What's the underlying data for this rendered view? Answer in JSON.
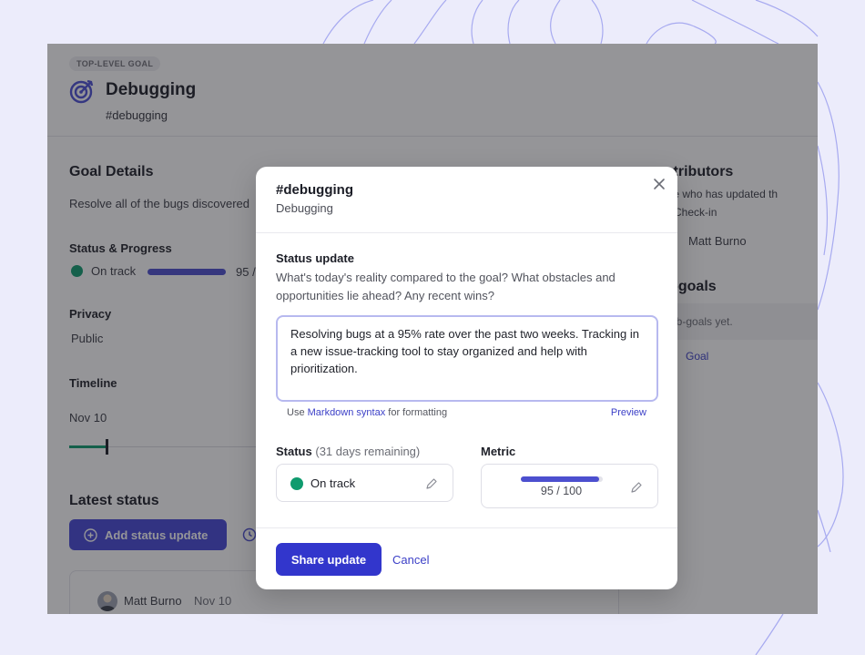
{
  "app": {
    "level_badge": "TOP-LEVEL GOAL",
    "goal_title": "Debugging",
    "goal_tag": "#debugging",
    "details": {
      "heading": "Goal Details",
      "description": "Resolve all of the bugs discovered",
      "status_label": "Status & Progress",
      "status_value": "On track",
      "progress_text": "95 /",
      "progress": 0.95,
      "privacy_label": "Privacy",
      "privacy_value": "Public",
      "timeline_label": "Timeline",
      "timeline_date": "Nov 10"
    },
    "latest": {
      "heading": "Latest status",
      "add_button": "Add status update",
      "author": "Matt Burno",
      "date": "Nov 10"
    },
    "right": {
      "contributors_heading": "ontributors",
      "contributors_note_1": "yone who has updated th",
      "contributors_note_2": "n a Check-in",
      "contributor_name": "Matt Burno",
      "subgoals_heading": "ub-goals",
      "subgoals_empty": "o sub-goals yet.",
      "add_goal": "Goal"
    }
  },
  "modal": {
    "title": "#debugging",
    "subtitle": "Debugging",
    "question_label": "Status update",
    "question_help": "What's today's reality compared to the goal? What obstacles and opportunities lie ahead? Any recent wins?",
    "update_text": "Resolving bugs at a 95% rate over the past two weeks. Tracking in a new issue-tracking tool to stay organized and help with prioritization.",
    "hint_prefix": "Use ",
    "hint_link": "Markdown syntax",
    "hint_suffix": " for formatting",
    "preview": "Preview",
    "status_label": "Status",
    "status_remaining": "(31 days remaining)",
    "status_value": "On track",
    "metric_label": "Metric",
    "metric_value": "95 / 100",
    "metric_progress": 0.95,
    "share_button": "Share update",
    "cancel_button": "Cancel"
  },
  "colors": {
    "accent": "#3236cc",
    "on_track": "#0f9b6e",
    "background": "#ececfb"
  }
}
